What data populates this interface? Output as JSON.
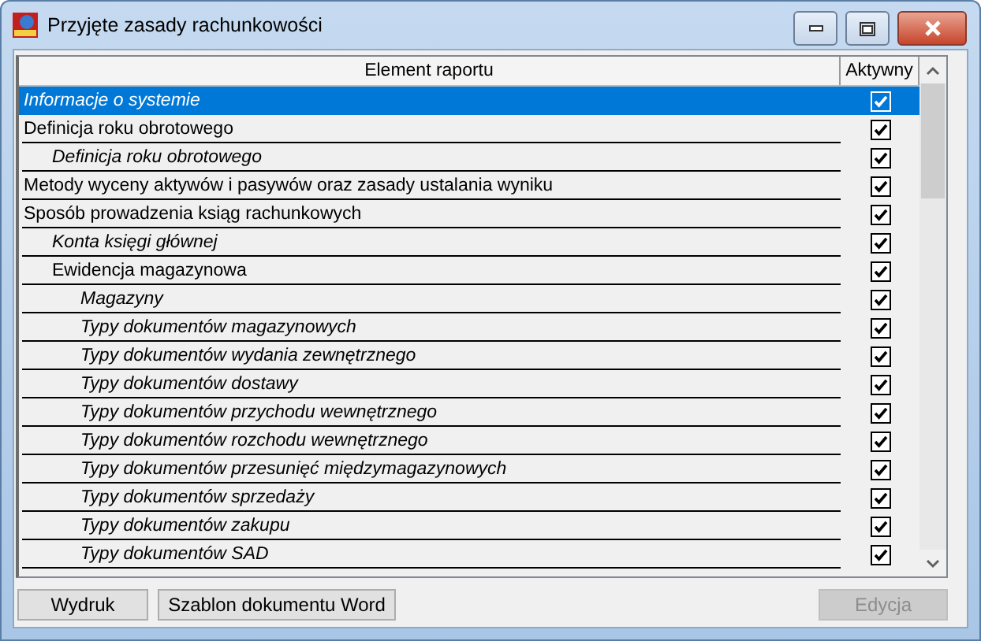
{
  "window": {
    "title": "Przyjęte zasady rachunkowości"
  },
  "table": {
    "columns": [
      "Element raportu",
      "Aktywny"
    ],
    "rows": [
      {
        "kind": "entry",
        "label": "Informacje o systemie",
        "checked": true,
        "selected": true
      },
      {
        "kind": "section",
        "label": "Definicja roku obrotowego",
        "checked": true,
        "selected": false,
        "children": [
          {
            "kind": "entry",
            "label": "Definicja roku obrotowego",
            "checked": true,
            "selected": false
          }
        ]
      },
      {
        "kind": "section",
        "label": "Metody wyceny aktywów i pasywów oraz zasady ustalania wyniku",
        "checked": true,
        "selected": false
      },
      {
        "kind": "section",
        "label": "Sposób prowadzenia ksiąg rachunkowych",
        "checked": true,
        "selected": false,
        "children": [
          {
            "kind": "entry",
            "label": "Konta księgi głównej",
            "checked": true,
            "selected": false
          },
          {
            "kind": "section",
            "label": "Ewidencja magazynowa",
            "checked": true,
            "selected": false,
            "children": [
              {
                "kind": "entry",
                "label": "Magazyny",
                "checked": true,
                "selected": false
              },
              {
                "kind": "entry",
                "label": "Typy dokumentów magazynowych",
                "checked": true,
                "selected": false
              },
              {
                "kind": "entry",
                "label": "Typy dokumentów wydania zewnętrznego",
                "checked": true,
                "selected": false
              },
              {
                "kind": "entry",
                "label": "Typy dokumentów dostawy",
                "checked": true,
                "selected": false
              },
              {
                "kind": "entry",
                "label": "Typy dokumentów przychodu wewnętrznego",
                "checked": true,
                "selected": false
              },
              {
                "kind": "entry",
                "label": "Typy dokumentów rozchodu wewnętrznego",
                "checked": true,
                "selected": false
              },
              {
                "kind": "entry",
                "label": "Typy dokumentów przesunięć międzymagazynowych",
                "checked": true,
                "selected": false
              },
              {
                "kind": "entry",
                "label": "Typy dokumentów sprzedaży",
                "checked": true,
                "selected": false
              },
              {
                "kind": "entry",
                "label": "Typy dokumentów zakupu",
                "checked": true,
                "selected": false
              },
              {
                "kind": "entry",
                "label": "Typy dokumentów SAD",
                "checked": true,
                "selected": false
              }
            ]
          }
        ]
      }
    ]
  },
  "buttons": [
    {
      "label": "Wydruk",
      "disabled": false
    },
    {
      "label": "Szablon dokumentu Word",
      "disabled": false
    },
    {
      "label": "Edycja",
      "disabled": true
    }
  ]
}
